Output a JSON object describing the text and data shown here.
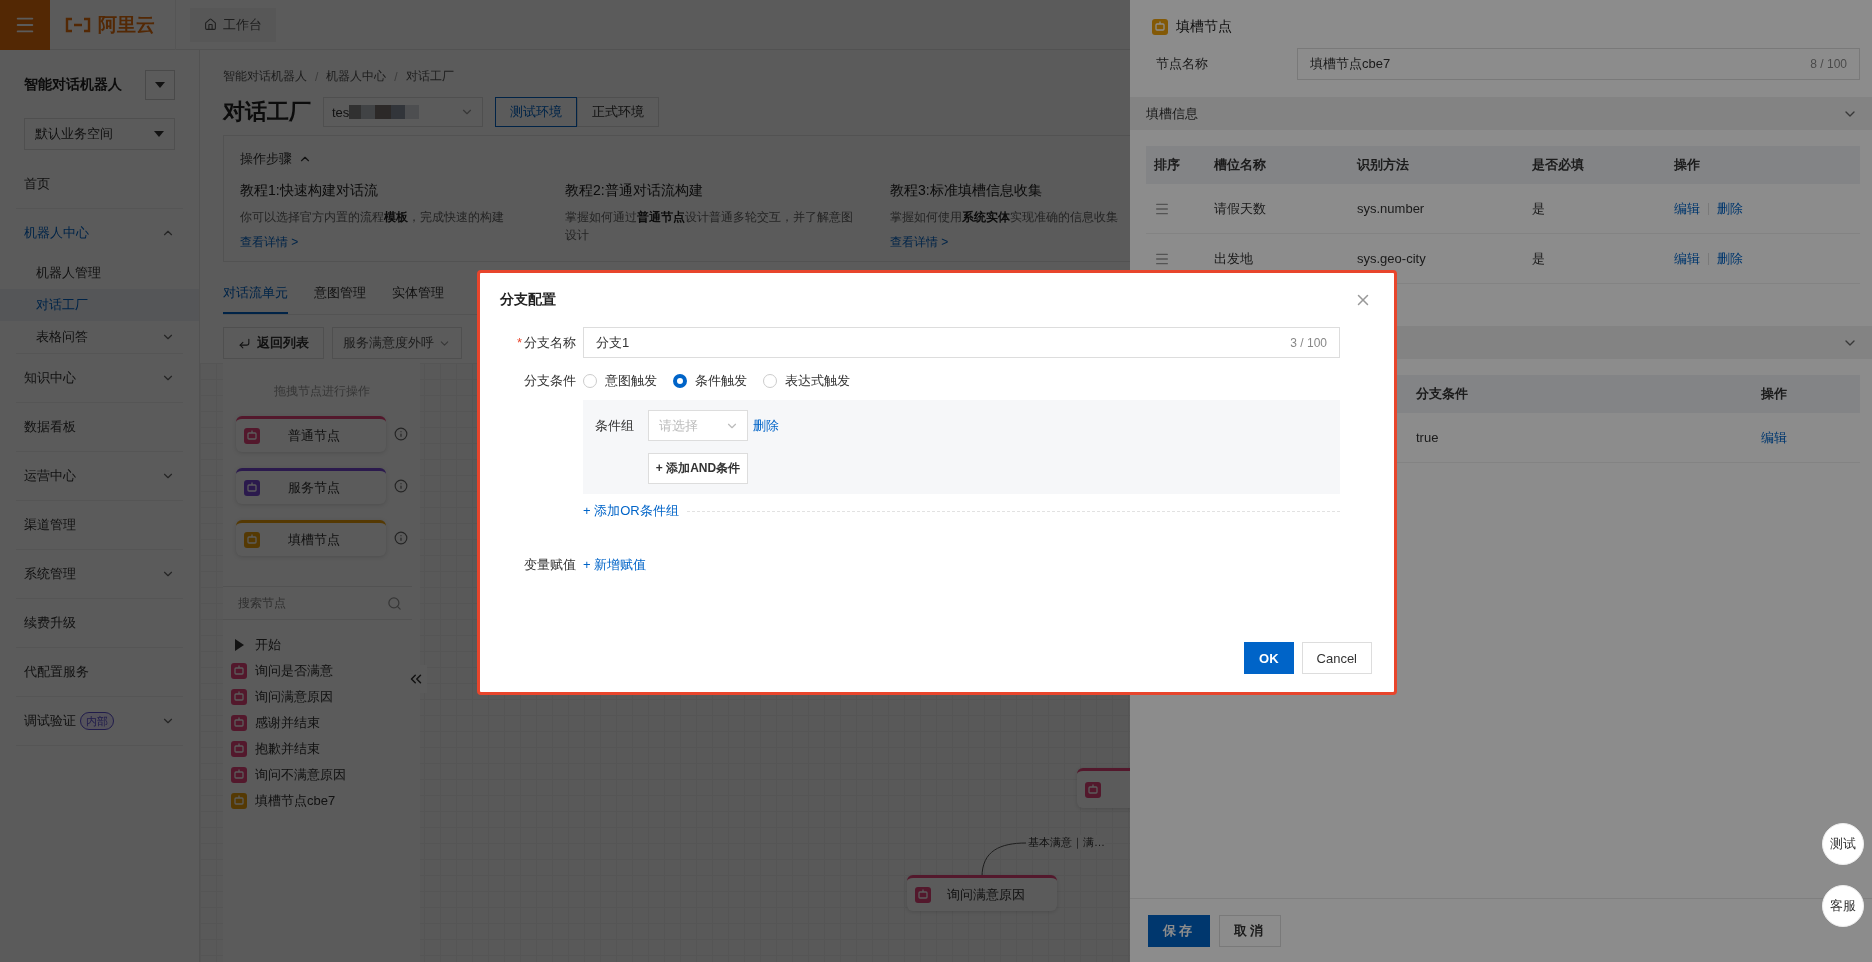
{
  "header": {
    "logo_text": "阿里云",
    "workbench_tab": "工作台"
  },
  "sidebar": {
    "title": "智能对话机器人",
    "workspace": "默认业务空间",
    "items": [
      {
        "kind": "link",
        "label": "首页",
        "selected": false
      },
      {
        "kind": "group",
        "label": "机器人中心",
        "expanded": true,
        "children": [
          {
            "kind": "link",
            "label": "机器人管理",
            "selected": false
          },
          {
            "kind": "link",
            "label": "对话工厂",
            "selected": true
          },
          {
            "kind": "group",
            "label": "表格问答",
            "expanded": false
          }
        ]
      },
      {
        "kind": "group",
        "label": "知识中心",
        "expanded": false
      },
      {
        "kind": "link",
        "label": "数据看板",
        "selected": false
      },
      {
        "kind": "group",
        "label": "运营中心",
        "expanded": false
      },
      {
        "kind": "link",
        "label": "渠道管理",
        "selected": false
      },
      {
        "kind": "group",
        "label": "系统管理",
        "expanded": false
      },
      {
        "kind": "link",
        "label": "续费升级",
        "selected": false
      },
      {
        "kind": "link",
        "label": "代配置服务",
        "selected": false
      },
      {
        "kind": "group",
        "label": "调试验证",
        "badge": "内部",
        "expanded": false
      }
    ]
  },
  "breadcrumb": [
    {
      "kind": "item",
      "text": "智能对话机器人"
    },
    {
      "kind": "separator",
      "text": "/"
    },
    {
      "kind": "item",
      "text": "机器人中心"
    },
    {
      "kind": "separator",
      "text": "/"
    },
    {
      "kind": "item",
      "text": "对话工厂"
    }
  ],
  "page_title": "对话工厂",
  "robot_select": {
    "value": "tes"
  },
  "environments": [
    {
      "label": "测试环境",
      "selected": true
    },
    {
      "label": "正式环境",
      "selected": false
    }
  ],
  "steps": {
    "title": "操作步骤",
    "expanded": true,
    "tutorials": [
      {
        "title": "教程1:快速构建对话流",
        "description": "你可以选择官方内置的流程**模板**，完成快速的构建",
        "link": "查看详情 >"
      },
      {
        "title": "教程2:普通对话流构建",
        "description": "掌握如何通过**普通节点**设计普通多轮交互，并了解意图设计"
      },
      {
        "title": "教程3:标准填槽信息收集",
        "description": "掌握如何使用**系统实体**实现准确的信息收集",
        "link": "查看详情 >"
      }
    ]
  },
  "tabs": [
    {
      "label": "对话流单元",
      "selected": true
    },
    {
      "label": "意图管理",
      "selected": false
    },
    {
      "label": "实体管理",
      "selected": false
    }
  ],
  "toolbar": {
    "back_button": "返回列表",
    "flow_select": "服务满意度外呼"
  },
  "node_palette": {
    "hint": "拖拽节点进行操作",
    "nodes": [
      {
        "label": "普通节点",
        "kind": "normal"
      },
      {
        "label": "服务节点",
        "kind": "service"
      },
      {
        "label": "填槽节点",
        "kind": "slot"
      }
    ]
  },
  "node_search": {
    "placeholder": "搜索节点"
  },
  "node_tree": [
    {
      "kind": "start",
      "label": "开始"
    },
    {
      "kind": "normal",
      "label": "询问是否满意"
    },
    {
      "kind": "normal",
      "label": "询问满意原因"
    },
    {
      "kind": "normal",
      "label": "感谢并结束"
    },
    {
      "kind": "normal",
      "label": "抱歉并结束"
    },
    {
      "kind": "normal",
      "label": "询问不满意原因"
    },
    {
      "kind": "slot",
      "label": "填槽节点cbe7"
    }
  ],
  "canvas": {
    "edge_label": "基本满意｜满…",
    "nodes": [
      {
        "kind": "normal"
      },
      {
        "kind": "normal",
        "label": "询问满意原因"
      }
    ]
  },
  "drawer": {
    "title": "填槽节点",
    "name_label": "节点名称",
    "name_value": "填槽节点cbe7",
    "name_count": "8 / 100",
    "slot_section": {
      "title": "填槽信息",
      "expanded": true,
      "columns": [
        "排序",
        "槽位名称",
        "识别方法",
        "是否必填",
        "操作"
      ],
      "rows": [
        {
          "name": "请假天数",
          "method": "sys.number",
          "required": "是",
          "actions": [
            "编辑",
            "删除"
          ]
        },
        {
          "name": "出发地",
          "method": "sys.geo-city",
          "required": "是",
          "actions": [
            "编辑",
            "删除"
          ]
        }
      ]
    },
    "branch_section": {
      "expanded": true,
      "columns": [
        "分支条件",
        "操作"
      ],
      "rows": [
        {
          "condition": "true",
          "actions": [
            "编辑"
          ]
        }
      ]
    },
    "save": "保存",
    "cancel": "取消"
  },
  "float_buttons": [
    "测试",
    "客服"
  ],
  "dialog": {
    "title": "分支配置",
    "name": {
      "label": "分支名称",
      "required_mark": "*",
      "value": "分支1",
      "count": "3 / 100"
    },
    "condition": {
      "label": "分支条件",
      "options": [
        {
          "label": "意图触发",
          "selected": false
        },
        {
          "label": "条件触发",
          "selected": true
        },
        {
          "label": "表达式触发",
          "selected": false
        }
      ],
      "group_label": "条件组",
      "select_placeholder": "请选择",
      "delete": "删除",
      "add_and": "+ 添加AND条件",
      "add_or": "+ 添加OR条件组"
    },
    "assign": {
      "label": "变量赋值",
      "add": "+ 新增赋值"
    },
    "ok": "OK",
    "cancel": "Cancel"
  }
}
